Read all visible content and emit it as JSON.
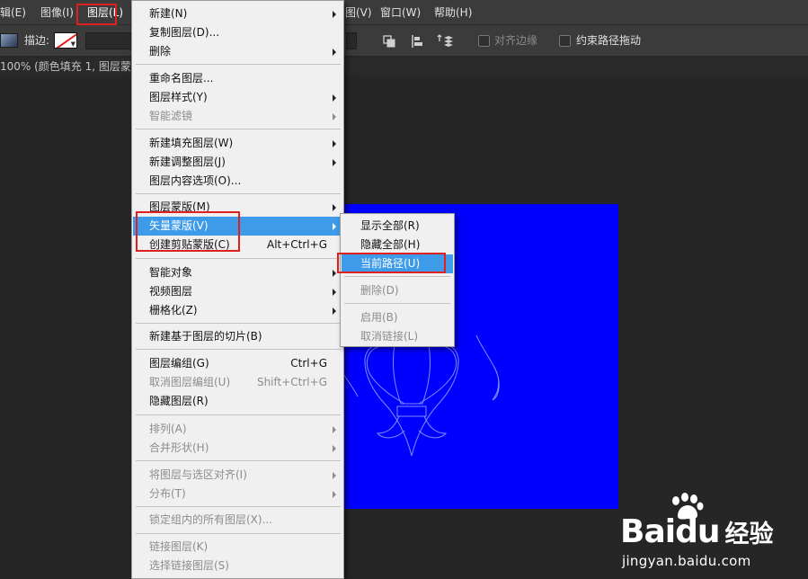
{
  "menubar": {
    "items": [
      {
        "label": "辑(E)"
      },
      {
        "label": "图像(I)"
      },
      {
        "label": "图层(L)"
      },
      {
        "label": "图(V)"
      },
      {
        "label": "窗口(W)"
      },
      {
        "label": "帮助(H)"
      }
    ]
  },
  "options": {
    "stroke_label": "描边:",
    "align_edges_label": "对齐边缘",
    "constrain_path_label": "约束路径拖动"
  },
  "document": {
    "tab_title": "100% (颜色填充 1, 图层蒙"
  },
  "layer_menu": {
    "items": [
      {
        "label": "新建(N)",
        "shortcut": "",
        "submenu": true,
        "enabled": true
      },
      {
        "label": "复制图层(D)...",
        "shortcut": "",
        "submenu": false,
        "enabled": true
      },
      {
        "label": "删除",
        "shortcut": "",
        "submenu": true,
        "enabled": true
      },
      {
        "label": "重命名图层...",
        "shortcut": "",
        "submenu": false,
        "enabled": true
      },
      {
        "label": "图层样式(Y)",
        "shortcut": "",
        "submenu": true,
        "enabled": true
      },
      {
        "label": "智能滤镜",
        "shortcut": "",
        "submenu": true,
        "enabled": false
      },
      {
        "label": "新建填充图层(W)",
        "shortcut": "",
        "submenu": true,
        "enabled": true
      },
      {
        "label": "新建调整图层(J)",
        "shortcut": "",
        "submenu": true,
        "enabled": true
      },
      {
        "label": "图层内容选项(O)...",
        "shortcut": "",
        "submenu": false,
        "enabled": true
      },
      {
        "label": "图层蒙版(M)",
        "shortcut": "",
        "submenu": true,
        "enabled": true
      },
      {
        "label": "矢量蒙版(V)",
        "shortcut": "",
        "submenu": true,
        "enabled": true,
        "highlighted": true
      },
      {
        "label": "创建剪贴蒙版(C)",
        "shortcut": "Alt+Ctrl+G",
        "submenu": false,
        "enabled": true
      },
      {
        "label": "智能对象",
        "shortcut": "",
        "submenu": true,
        "enabled": true
      },
      {
        "label": "视频图层",
        "shortcut": "",
        "submenu": true,
        "enabled": true
      },
      {
        "label": "栅格化(Z)",
        "shortcut": "",
        "submenu": true,
        "enabled": true
      },
      {
        "label": "新建基于图层的切片(B)",
        "shortcut": "",
        "submenu": false,
        "enabled": true
      },
      {
        "label": "图层编组(G)",
        "shortcut": "Ctrl+G",
        "submenu": false,
        "enabled": true
      },
      {
        "label": "取消图层编组(U)",
        "shortcut": "Shift+Ctrl+G",
        "submenu": false,
        "enabled": false
      },
      {
        "label": "隐藏图层(R)",
        "shortcut": "",
        "submenu": false,
        "enabled": true
      },
      {
        "label": "排列(A)",
        "shortcut": "",
        "submenu": true,
        "enabled": false
      },
      {
        "label": "合并形状(H)",
        "shortcut": "",
        "submenu": true,
        "enabled": false
      },
      {
        "label": "将图层与选区对齐(I)",
        "shortcut": "",
        "submenu": true,
        "enabled": false
      },
      {
        "label": "分布(T)",
        "shortcut": "",
        "submenu": true,
        "enabled": false
      },
      {
        "label": "锁定组内的所有图层(X)...",
        "shortcut": "",
        "submenu": false,
        "enabled": false
      },
      {
        "label": "链接图层(K)",
        "shortcut": "",
        "submenu": false,
        "enabled": false
      },
      {
        "label": "选择链接图层(S)",
        "shortcut": "",
        "submenu": false,
        "enabled": false
      }
    ]
  },
  "vector_mask_submenu": {
    "items": [
      {
        "label": "显示全部(R)",
        "enabled": true
      },
      {
        "label": "隐藏全部(H)",
        "enabled": true
      },
      {
        "label": "当前路径(U)",
        "enabled": true,
        "highlighted": true
      },
      {
        "label": "删除(D)",
        "enabled": false
      },
      {
        "label": "启用(B)",
        "enabled": false
      },
      {
        "label": "取消链接(L)",
        "enabled": false
      }
    ]
  },
  "watermark": {
    "brand_latin": "Bai",
    "brand_latin_2": "du",
    "brand_cn": "经验",
    "url": "jingyan.baidu.com"
  },
  "colors": {
    "canvas_fill": "#0000ff",
    "menu_highlight": "#3d9be9",
    "annotation_red": "#e0201e",
    "app_background": "#262626"
  }
}
